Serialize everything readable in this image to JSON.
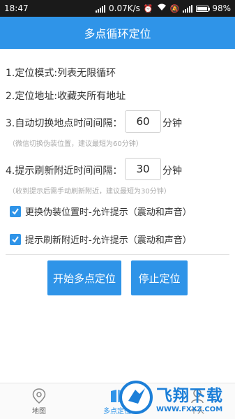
{
  "status_bar": {
    "time": "18:47",
    "net_speed": "0.07K/s",
    "battery": "98%"
  },
  "header": {
    "title": "多点循环定位"
  },
  "settings": {
    "mode_line": "1.定位模式:列表无限循环",
    "address_line": "2.定位地址:收藏夹所有地址",
    "switch_label": "3.自动切换地点时间间隔：",
    "switch_value": "60",
    "switch_unit": "分钟",
    "switch_hint": "（微信切换伪装位置，建议最短为60分钟）",
    "refresh_label": "4.提示刷新附近时间间隔：",
    "refresh_value": "30",
    "refresh_unit": "分钟",
    "refresh_hint": "（收到提示后需手动刷新附近，建议最短为30分钟）",
    "check1_label": "更换伪装位置时-允许提示（震动和声音）",
    "check2_label": "提示刷新附近时-允许提示（震动和声音）"
  },
  "buttons": {
    "start": "开始多点定位",
    "stop": "停止定位"
  },
  "nav": {
    "items": [
      {
        "label": "地图",
        "icon": "map-pin-icon"
      },
      {
        "label": "多点定位",
        "icon": "book-icon"
      },
      {
        "label": "个人",
        "icon": "person-icon"
      }
    ]
  },
  "watermark": {
    "title": "飞翔下载",
    "url": "WWW.FXXZ.COM"
  },
  "colors": {
    "accent": "#2f94e8",
    "status_bar": "#1a1a1a"
  }
}
